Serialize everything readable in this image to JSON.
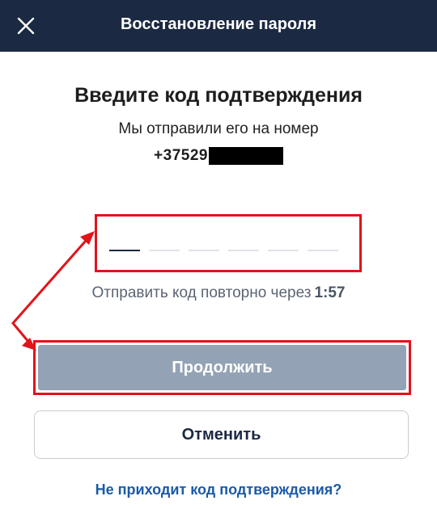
{
  "header": {
    "title": "Восстановление пароля",
    "close_icon": "close-icon"
  },
  "main": {
    "heading": "Введите код подтверждения",
    "subtext": "Мы отправили его на номер",
    "phone_prefix": "+37529",
    "code": {
      "slots": 6,
      "filled": 0
    },
    "resend_text": "Отправить код повторно через",
    "resend_timer": "1:57",
    "continue_label": "Продолжить",
    "cancel_label": "Отменить",
    "help_link": "Не приходит код подтверждения?"
  },
  "colors": {
    "header_bg": "#1b2942",
    "annotation_red": "#e0141b",
    "continue_disabled_bg": "#93a3b5",
    "link": "#1c5aa8"
  }
}
